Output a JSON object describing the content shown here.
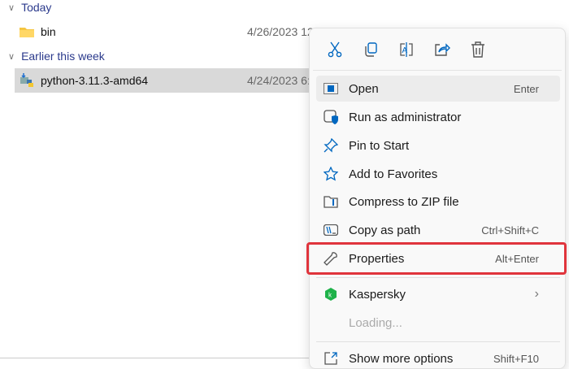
{
  "groups": [
    {
      "label": "Today"
    },
    {
      "label": "Earlier this week"
    }
  ],
  "files": [
    {
      "name": "bin",
      "date": "4/26/2023 12:"
    },
    {
      "name": "python-3.11.3-amd64",
      "date": "4/24/2023 6:4"
    }
  ],
  "menu": {
    "toolbar": [
      "cut",
      "copy",
      "rename",
      "share",
      "delete"
    ],
    "items": [
      {
        "label": "Open",
        "shortcut": "Enter"
      },
      {
        "label": "Run as administrator",
        "shortcut": ""
      },
      {
        "label": "Pin to Start",
        "shortcut": ""
      },
      {
        "label": "Add to Favorites",
        "shortcut": ""
      },
      {
        "label": "Compress to ZIP file",
        "shortcut": ""
      },
      {
        "label": "Copy as path",
        "shortcut": "Ctrl+Shift+C"
      },
      {
        "label": "Properties",
        "shortcut": "Alt+Enter"
      },
      {
        "label": "Kaspersky",
        "shortcut": "›"
      },
      {
        "label": "Loading...",
        "shortcut": ""
      },
      {
        "label": "Show more options",
        "shortcut": "Shift+F10"
      }
    ]
  },
  "colors": {
    "accent": "#0067c0",
    "highlight": "#e0343c"
  }
}
